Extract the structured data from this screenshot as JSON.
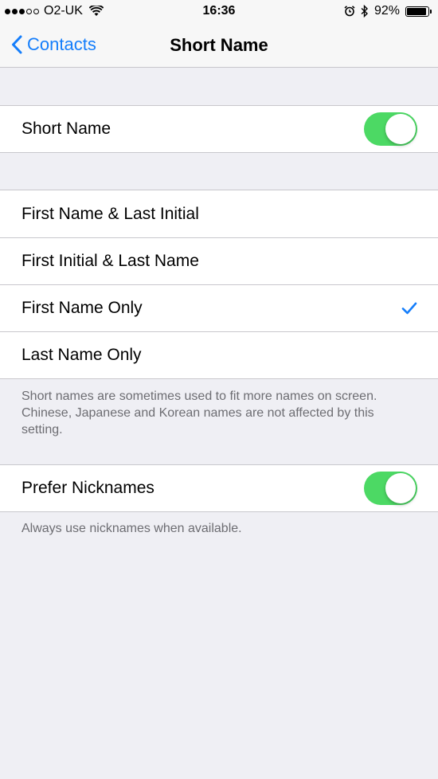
{
  "status_bar": {
    "carrier": "O2-UK",
    "time": "16:36",
    "battery_percent": "92%",
    "battery_level": 0.92,
    "signal_bars": [
      true,
      true,
      true,
      false,
      false
    ],
    "icons": [
      "wifi-icon",
      "alarm-icon",
      "bluetooth-icon",
      "battery-icon"
    ]
  },
  "nav": {
    "back_label": "Contacts",
    "title": "Short Name"
  },
  "short_name_toggle": {
    "label": "Short Name",
    "on": true
  },
  "options": {
    "items": [
      {
        "label": "First Name & Last Initial",
        "selected": false
      },
      {
        "label": "First Initial & Last Name",
        "selected": false
      },
      {
        "label": "First Name Only",
        "selected": true
      },
      {
        "label": "Last Name Only",
        "selected": false
      }
    ],
    "footer": "Short names are sometimes used to fit more names on screen. Chinese, Japanese and Korean names are not affected by this setting."
  },
  "nicknames": {
    "label": "Prefer Nicknames",
    "on": true,
    "footer": "Always use nicknames when available."
  },
  "colors": {
    "accent": "#157efb",
    "toggle_on": "#4cd964",
    "background": "#efeff4",
    "footer_text": "#6d6d72"
  }
}
